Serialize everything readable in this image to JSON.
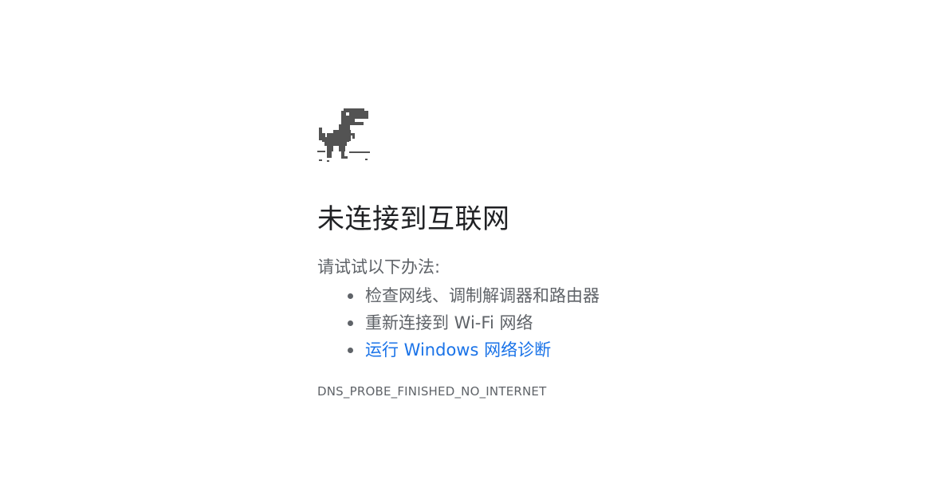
{
  "main": {
    "title": "未连接到互联网",
    "try_label": "请试试以下办法:",
    "suggestions": [
      {
        "text": "检查网线、调制解调器和路由器",
        "link": false
      },
      {
        "text": "重新连接到 Wi-Fi 网络",
        "link": false
      },
      {
        "text": "运行 Windows 网络诊断",
        "link": true
      }
    ],
    "error_code": "DNS_PROBE_FINISHED_NO_INTERNET"
  },
  "icons": {
    "offline": "offline-dino-icon"
  },
  "colors": {
    "title": "#202124",
    "body_text": "#5f6368",
    "link": "#1a73e8",
    "dino": "#535353",
    "background": "#ffffff"
  }
}
